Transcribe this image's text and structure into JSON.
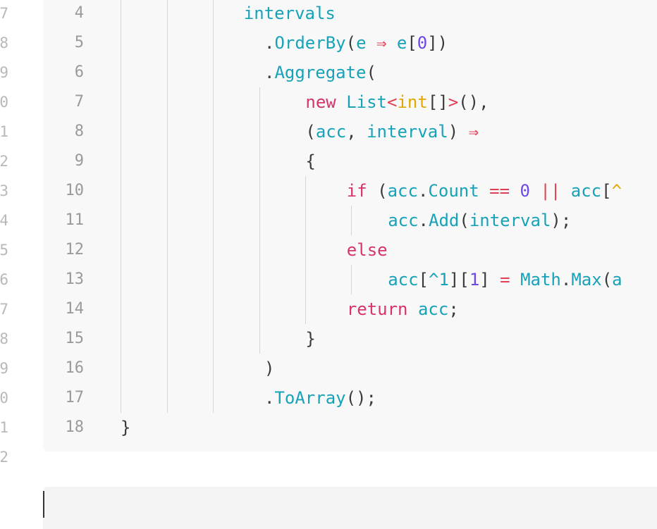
{
  "outer_gutter": [
    "7",
    "8",
    "9",
    "0",
    "1",
    "2",
    "3",
    "4",
    "5",
    "6",
    "7",
    "8",
    "9",
    "0",
    "1",
    "2"
  ],
  "code": {
    "line_numbers": [
      "4",
      "5",
      "6",
      "7",
      "8",
      "9",
      "10",
      "11",
      "12",
      "13",
      "14",
      "15",
      "16",
      "17",
      "18"
    ],
    "lines": [
      [
        {
          "c": "id",
          "t": "intervals"
        }
      ],
      [
        {
          "c": "p",
          "t": "."
        },
        {
          "c": "id",
          "t": "OrderBy"
        },
        {
          "c": "p",
          "t": "("
        },
        {
          "c": "id",
          "t": "e"
        },
        {
          "c": "p",
          "t": " "
        },
        {
          "c": "op",
          "t": "⇒"
        },
        {
          "c": "p",
          "t": " "
        },
        {
          "c": "id",
          "t": "e"
        },
        {
          "c": "p",
          "t": "["
        },
        {
          "c": "num",
          "t": "0"
        },
        {
          "c": "p",
          "t": "])"
        }
      ],
      [
        {
          "c": "p",
          "t": "."
        },
        {
          "c": "id",
          "t": "Aggregate"
        },
        {
          "c": "p",
          "t": "("
        }
      ],
      [
        {
          "c": "kw",
          "t": "new"
        },
        {
          "c": "p",
          "t": " "
        },
        {
          "c": "id",
          "t": "List"
        },
        {
          "c": "op",
          "t": "<"
        },
        {
          "c": "ty",
          "t": "int"
        },
        {
          "c": "p",
          "t": "[]"
        },
        {
          "c": "op",
          "t": ">"
        },
        {
          "c": "p",
          "t": "(),"
        }
      ],
      [
        {
          "c": "p",
          "t": "("
        },
        {
          "c": "id",
          "t": "acc"
        },
        {
          "c": "p",
          "t": ", "
        },
        {
          "c": "id",
          "t": "interval"
        },
        {
          "c": "p",
          "t": ") "
        },
        {
          "c": "op",
          "t": "⇒"
        }
      ],
      [
        {
          "c": "p",
          "t": "{"
        }
      ],
      [
        {
          "c": "kw",
          "t": "if"
        },
        {
          "c": "p",
          "t": " ("
        },
        {
          "c": "id",
          "t": "acc"
        },
        {
          "c": "p",
          "t": "."
        },
        {
          "c": "id",
          "t": "Count"
        },
        {
          "c": "p",
          "t": " "
        },
        {
          "c": "op",
          "t": "=="
        },
        {
          "c": "p",
          "t": " "
        },
        {
          "c": "num",
          "t": "0"
        },
        {
          "c": "p",
          "t": " "
        },
        {
          "c": "op",
          "t": "||"
        },
        {
          "c": "p",
          "t": " "
        },
        {
          "c": "id",
          "t": "acc"
        },
        {
          "c": "p",
          "t": "["
        },
        {
          "c": "ty",
          "t": "^"
        }
      ],
      [
        {
          "c": "id",
          "t": "acc"
        },
        {
          "c": "p",
          "t": "."
        },
        {
          "c": "id",
          "t": "Add"
        },
        {
          "c": "p",
          "t": "("
        },
        {
          "c": "id",
          "t": "interval"
        },
        {
          "c": "p",
          "t": ");"
        }
      ],
      [
        {
          "c": "kw",
          "t": "else"
        }
      ],
      [
        {
          "c": "id",
          "t": "acc"
        },
        {
          "c": "p",
          "t": "["
        },
        {
          "c": "id",
          "t": "^1"
        },
        {
          "c": "p",
          "t": "]["
        },
        {
          "c": "num",
          "t": "1"
        },
        {
          "c": "p",
          "t": "] "
        },
        {
          "c": "op",
          "t": "="
        },
        {
          "c": "p",
          "t": " "
        },
        {
          "c": "id",
          "t": "Math"
        },
        {
          "c": "p",
          "t": "."
        },
        {
          "c": "id",
          "t": "Max"
        },
        {
          "c": "p",
          "t": "("
        },
        {
          "c": "id",
          "t": "a"
        }
      ],
      [
        {
          "c": "kw",
          "t": "return"
        },
        {
          "c": "p",
          "t": " "
        },
        {
          "c": "id",
          "t": "acc"
        },
        {
          "c": "p",
          "t": ";"
        }
      ],
      [
        {
          "c": "p",
          "t": "}"
        }
      ],
      [
        {
          "c": "p",
          "t": ")"
        }
      ],
      [
        {
          "c": "p",
          "t": "."
        },
        {
          "c": "id",
          "t": "ToArray"
        },
        {
          "c": "p",
          "t": "();"
        }
      ],
      [
        {
          "c": "p",
          "t": "}"
        }
      ]
    ]
  },
  "colors": {
    "keyword": "#d6336c",
    "identifier": "#17a2b8",
    "type": "#e0a800",
    "number": "#7048e8",
    "operator": "#e03e52",
    "punctuation": "#3a3a3a",
    "line_number": "#9a9a9a",
    "block_background": "#f8f8f8"
  }
}
